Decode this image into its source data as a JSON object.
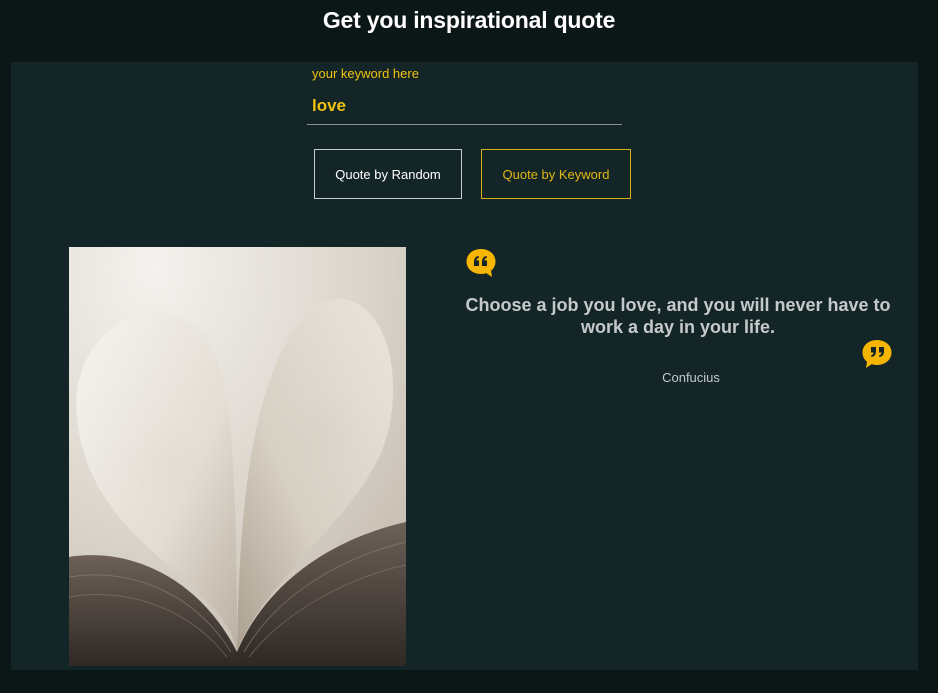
{
  "header": {
    "title": "Get you inspirational quote"
  },
  "search": {
    "label": "your keyword here",
    "value": "love"
  },
  "buttons": {
    "random_label": "Quote by Random",
    "keyword_label": "Quote by Keyword"
  },
  "quote": {
    "text": "Choose a job you love, and you will never have to work a day in your life.",
    "author": "Confucius",
    "image_alt": "book pages folded into a heart"
  },
  "icons": {
    "open_quote": "quote-open-icon",
    "close_quote": "quote-close-icon"
  },
  "colors": {
    "accent": "#f0c20f",
    "background": "#0b1617",
    "panel": "#132527"
  }
}
